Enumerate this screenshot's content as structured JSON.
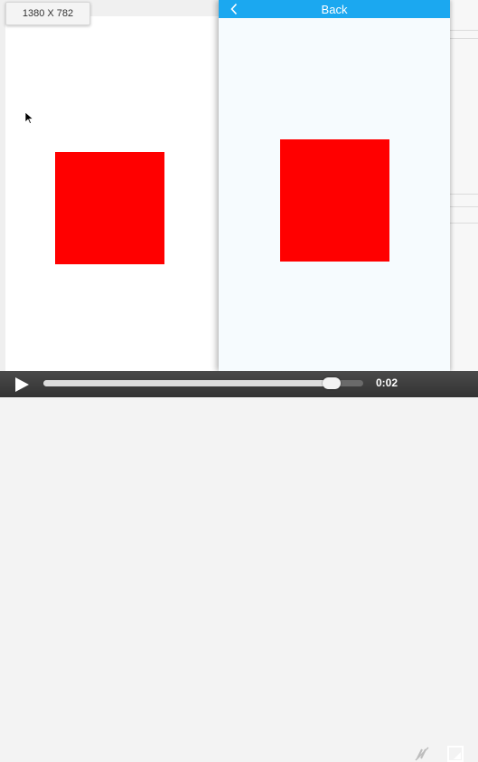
{
  "size_badge": {
    "label": "1380 X 782"
  },
  "phone": {
    "nav_title": "Back"
  },
  "video": {
    "time": "0:02",
    "progress": 0.9
  },
  "colors": {
    "nav_blue": "#1ba8f0",
    "square_red": "#ff0000"
  },
  "icons": [
    "cursor-icon",
    "back-chevron-icon",
    "play-icon",
    "captions-off-icon",
    "fullscreen-icon"
  ]
}
